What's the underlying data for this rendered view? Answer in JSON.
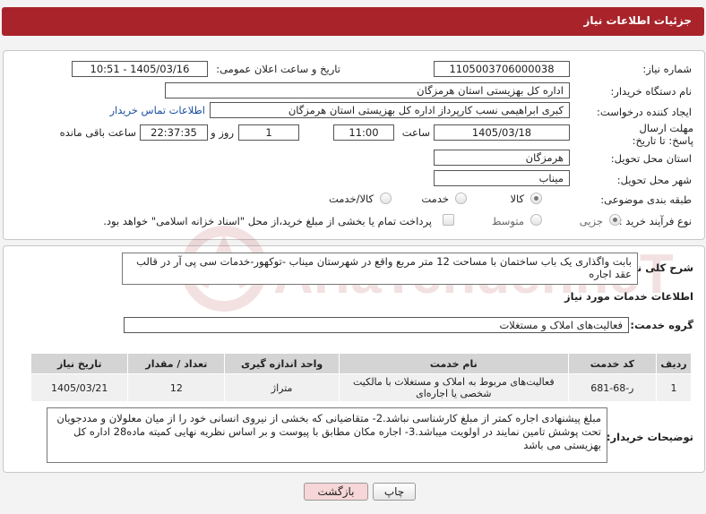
{
  "header": {
    "title": "جزئیات اطلاعات نیاز"
  },
  "form": {
    "need_number_label": "شماره نیاز:",
    "need_number": "1105003706000038",
    "announce_label": "تاریخ و ساعت اعلان عمومی:",
    "announce_value": "1405/03/16 - 10:51",
    "buyer_org_label": "نام دستگاه خریدار:",
    "buyer_org": "اداره کل بهزیستی استان هرمزگان",
    "creator_label": "ایجاد کننده درخواست:",
    "creator": "کبری  ابراهیمی نسب کارپرداز اداره کل بهزیستی استان هرمزگان",
    "contact_link": "اطلاعات تماس خریدار",
    "deadline_label": "مهلت ارسال پاسخ: تا تاریخ:",
    "deadline_date": "1405/03/18",
    "time_label": "ساعت",
    "deadline_time": "11:00",
    "days_value": "1",
    "days_label": "روز و",
    "remaining_time": "22:37:35",
    "remaining_label": "ساعت باقی مانده",
    "province_label": "استان محل تحویل:",
    "province": "هرمزگان",
    "city_label": "شهر محل تحویل:",
    "city": "میناب",
    "category_label": "طبقه بندی موضوعی:",
    "category_options": [
      "کالا",
      "خدمت",
      "کالا/خدمت"
    ],
    "process_label": "نوع فرآیند خرید :",
    "process_options": [
      "جزیی",
      "متوسط"
    ],
    "payment_note": "پرداخت تمام یا بخشی از مبلغ خرید،از محل \"اسناد خزانه اسلامی\" خواهد بود."
  },
  "summary": {
    "label": "شرح کلی نیاز:",
    "text": "بابت واگذاری یک باب ساختمان با مساحت 12  متر مربع واقع در شهرستان میناب -توکهور-خدمات سی پی آر در قالب عقد اجاره"
  },
  "services": {
    "title": "اطلاعات خدمات مورد نیاز",
    "group_label": "گروه خدمت:",
    "group_value": "فعالیت‌های  املاک و مستغلات",
    "columns": [
      "ردیف",
      "کد خدمت",
      "نام خدمت",
      "واحد اندازه گیری",
      "تعداد / مقدار",
      "تاریخ نیاز"
    ],
    "rows": [
      [
        "1",
        "ر-68-681",
        "فعالیت‌های مربوط به املاک و مستغلات با مالکیت شخصی یا اجاره‌ای",
        "متراژ",
        "12",
        "1405/03/21"
      ]
    ]
  },
  "notes": {
    "label": "توضیحات خریدار:",
    "text": "مبلغ پیشنهادی  اجاره کمتر از مبلغ کارشناسی نباشد.2- متقاضیانی که بخشی از نیروی انسانی خود را از میان معلولان و مددجویان تحت پوشش تامین نمایند در اولویت میباشد.3-  اجاره مکان  مطابق با پیوست و بر اساس نظریه نهایی کمیته ماده28 اداره کل بهزیستی می باشد"
  },
  "buttons": {
    "print": "چاپ",
    "back": "بازگشت"
  },
  "watermark": {
    "text": "AriaTender.neT"
  },
  "colors": {
    "header": "#a8242a",
    "link": "#1a4fa0",
    "back_button": "#f6d6d6"
  }
}
